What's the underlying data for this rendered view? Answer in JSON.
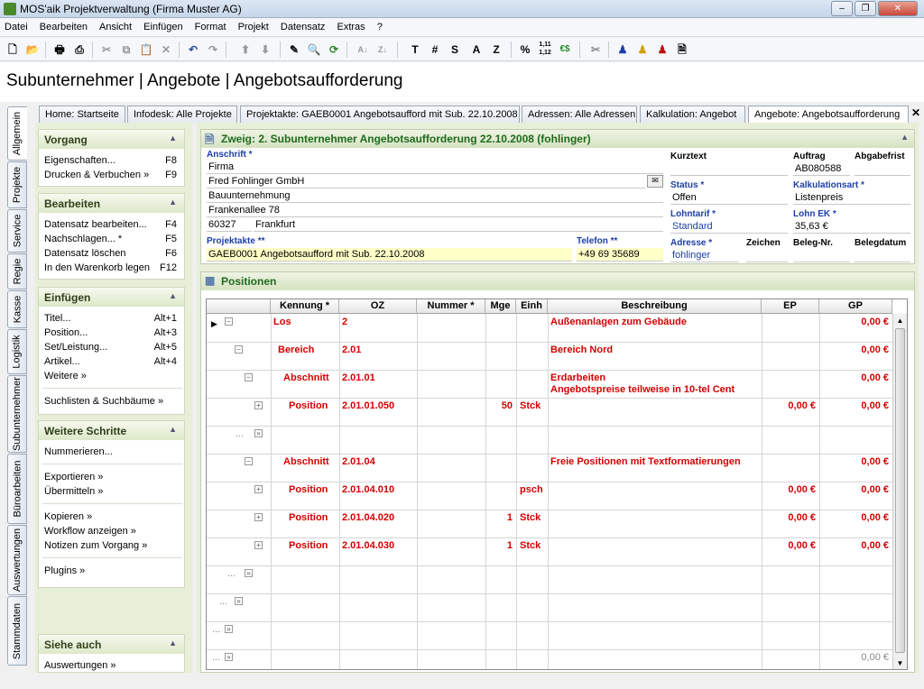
{
  "window": {
    "title": "MOS'aik Projektverwaltung (Firma Muster AG)"
  },
  "menu": [
    "Datei",
    "Bearbeiten",
    "Ansicht",
    "Einfügen",
    "Format",
    "Projekt",
    "Datensatz",
    "Extras",
    "?"
  ],
  "toolbar_text": {
    "t": "T",
    "hash": "#",
    "s": "S",
    "a": "A",
    "z": "Z",
    "percent": "%",
    "nums": "1,11\n1,12",
    "euro": "€$"
  },
  "header_title": "Subunternehmer | Angebote | Angebotsaufforderung",
  "vertical_tabs": [
    "Allgemein",
    "Projekte",
    "Service",
    "Regie",
    "Kasse",
    "Logistik",
    "Subunternehmer",
    "Büroarbeiten",
    "Auswertungen",
    "Stammdaten"
  ],
  "doc_tabs": [
    "Home: Startseite",
    "Infodesk: Alle Projekte",
    "Projektakte: GAEB0001 Angebotsaufford mit Sub. 22.10.2008",
    "Adressen: Alle Adressen",
    "Kalkulation: Angebot",
    "Angebote: Angebotsaufforderung"
  ],
  "close_glyph": "✕",
  "left": {
    "vorgang": {
      "title": "Vorgang",
      "items": [
        {
          "label": "Eigenschaften...",
          "key": "F8"
        },
        {
          "label": "Drucken & Verbuchen »",
          "key": "F9"
        }
      ]
    },
    "bearbeiten": {
      "title": "Bearbeiten",
      "items": [
        {
          "label": "Datensatz bearbeiten...",
          "key": "F4"
        },
        {
          "label": "Nachschlagen... *",
          "key": "F5"
        },
        {
          "label": "Datensatz löschen",
          "key": "F6"
        },
        {
          "label": "In den Warenkorb legen",
          "key": "F12"
        }
      ]
    },
    "einfuegen": {
      "title": "Einfügen",
      "items": [
        {
          "label": "Titel...",
          "key": "Alt+1"
        },
        {
          "label": "Position...",
          "key": "Alt+3"
        },
        {
          "label": "Set/Leistung...",
          "key": "Alt+5"
        },
        {
          "label": "Artikel...",
          "key": "Alt+4"
        },
        {
          "label": "Weitere »",
          "key": ""
        },
        {
          "label": "Suchlisten & Suchbäume »",
          "key": ""
        }
      ]
    },
    "weitere": {
      "title": "Weitere Schritte",
      "items": [
        "Nummerieren...",
        "Exportieren »",
        "Übermitteln »",
        "Kopieren »",
        "Workflow anzeigen »",
        "Notizen zum Vorgang »",
        "Plugins »"
      ]
    },
    "siehe": {
      "title": "Siehe auch",
      "items": [
        "Auswertungen »"
      ]
    }
  },
  "detail": {
    "title": "Zweig: 2. Subunternehmer Angebotsaufforderung 22.10.2008 (fohlinger)",
    "anschrift_label": "Anschrift *",
    "address": [
      "Firma",
      "Fred Fohlinger GmbH",
      "Bauunternehmung",
      "Frankenallee 78"
    ],
    "plz": "60327",
    "ort": "Frankfurt",
    "kurztext_label": "Kurztext",
    "kurztext": "",
    "auftrag_label": "Auftrag",
    "auftrag": "AB080588",
    "abgabefrist_label": "Abgabefrist",
    "abgabefrist": "",
    "status_label": "Status *",
    "status": "Offen",
    "kalk_label": "Kalkulationsart *",
    "kalk": "Listenpreis",
    "lohntarif_label": "Lohntarif *",
    "lohntarif": "Standard",
    "lohnek_label": "Lohn EK *",
    "lohnek": "35,63 €",
    "projektakte_label": "Projektakte **",
    "projektakte": "GAEB0001 Angebotsaufford mit Sub. 22.10.2008",
    "telefon_label": "Telefon **",
    "telefon": "+49 69 35689",
    "adresse_label": "Adresse *",
    "adresse": "fohlinger",
    "zeichen_label": "Zeichen",
    "zeichen": "",
    "belegnr_label": "Beleg-Nr.",
    "belegnr": "",
    "belegdatum_label": "Belegdatum",
    "belegdatum": ""
  },
  "positionen": {
    "title": "Positionen",
    "columns": [
      "Kennung *",
      "OZ",
      "Nummer *",
      "Mge",
      "Einh",
      "Beschreibung",
      "EP",
      "GP"
    ],
    "rows": [
      {
        "kennung": "Los",
        "oz": "2",
        "nummer": "",
        "mge": "",
        "einh": "",
        "beschreibung": "Außenanlagen zum Gebäude",
        "beschreibung2": "",
        "ep": "",
        "gp": "0,00 €"
      },
      {
        "kennung": "Bereich",
        "oz": "2.01",
        "nummer": "",
        "mge": "",
        "einh": "",
        "beschreibung": "Bereich Nord",
        "beschreibung2": "",
        "ep": "",
        "gp": "0,00 €"
      },
      {
        "kennung": "Abschnitt",
        "oz": "2.01.01",
        "nummer": "",
        "mge": "",
        "einh": "",
        "beschreibung": "Erdarbeiten",
        "beschreibung2": "Angebotspreise teilweise in 10-tel Cent",
        "ep": "",
        "gp": "0,00 €"
      },
      {
        "kennung": "Position",
        "oz": "2.01.01.050",
        "nummer": "",
        "mge": "50",
        "einh": "Stck",
        "beschreibung": "",
        "beschreibung2": "",
        "ep": "0,00 €",
        "gp": "0,00 €"
      },
      {
        "kennung": "...",
        "oz": "",
        "nummer": "",
        "mge": "",
        "einh": "",
        "beschreibung": "",
        "beschreibung2": "",
        "ep": "",
        "gp": ""
      },
      {
        "kennung": "Abschnitt",
        "oz": "2.01.04",
        "nummer": "",
        "mge": "",
        "einh": "",
        "beschreibung": "Freie Positionen mit Textformatierungen",
        "beschreibung2": "",
        "ep": "",
        "gp": "0,00 €"
      },
      {
        "kennung": "Position",
        "oz": "2.01.04.010",
        "nummer": "",
        "mge": "",
        "einh": "psch",
        "beschreibung": "",
        "beschreibung2": "",
        "ep": "0,00 €",
        "gp": "0,00 €"
      },
      {
        "kennung": "Position",
        "oz": "2.01.04.020",
        "nummer": "",
        "mge": "1",
        "einh": "Stck",
        "beschreibung": "",
        "beschreibung2": "",
        "ep": "0,00 €",
        "gp": "0,00 €"
      },
      {
        "kennung": "Position",
        "oz": "2.01.04.030",
        "nummer": "",
        "mge": "1",
        "einh": "Stck",
        "beschreibung": "",
        "beschreibung2": "",
        "ep": "0,00 €",
        "gp": "0,00 €"
      },
      {
        "kennung": "...",
        "oz": "",
        "nummer": "",
        "mge": "",
        "einh": "",
        "beschreibung": "",
        "beschreibung2": "",
        "ep": "",
        "gp": ""
      },
      {
        "kennung": "...",
        "oz": "",
        "nummer": "",
        "mge": "",
        "einh": "",
        "beschreibung": "",
        "beschreibung2": "",
        "ep": "",
        "gp": ""
      },
      {
        "kennung": "...",
        "oz": "",
        "nummer": "",
        "mge": "",
        "einh": "",
        "beschreibung": "",
        "beschreibung2": "",
        "ep": "",
        "gp": ""
      },
      {
        "kennung": "...",
        "oz": "",
        "nummer": "",
        "mge": "",
        "einh": "",
        "beschreibung": "",
        "beschreibung2": "",
        "ep": "",
        "gp": "0,00 €"
      }
    ]
  },
  "colors": {
    "accent_green": "#1d6b1d",
    "position_red": "#d40000",
    "label_blue": "#1c3fa4",
    "yellow": "#ffffc8"
  }
}
